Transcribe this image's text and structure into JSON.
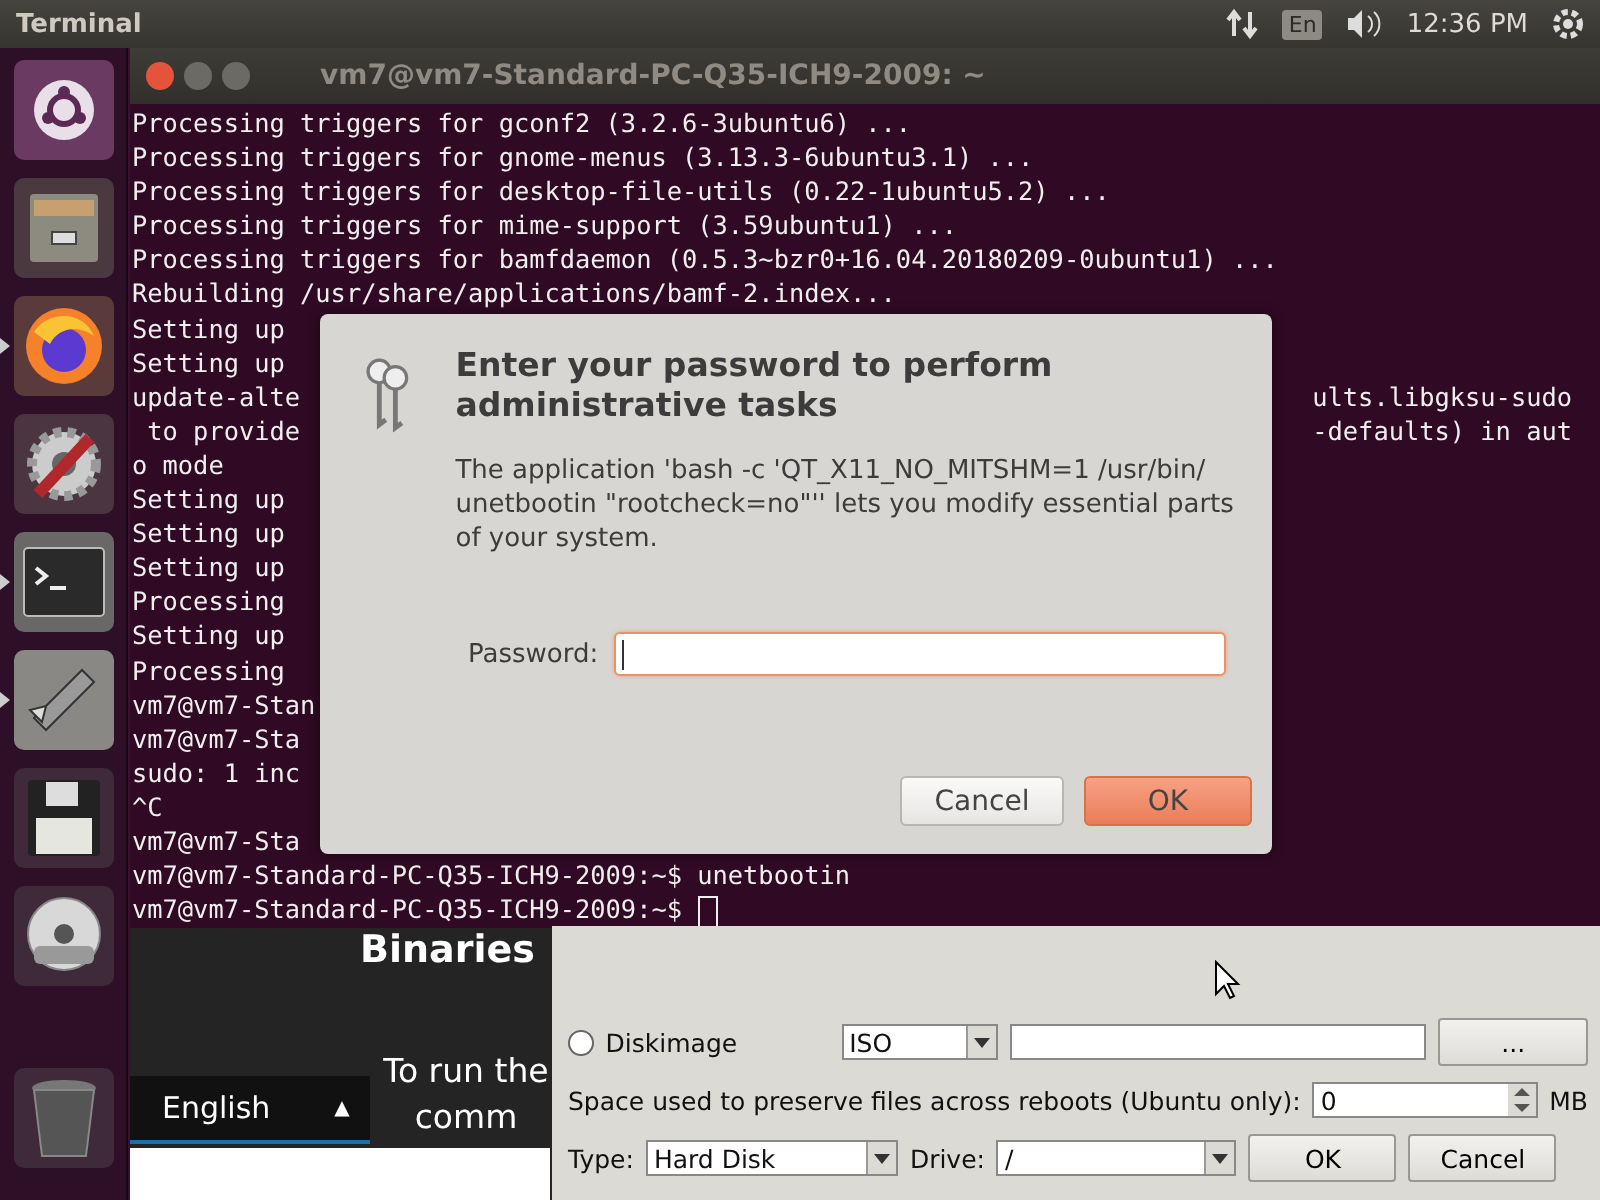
{
  "top_bar": {
    "app_title": "Terminal",
    "keyboard_layout": "En",
    "clock": "12:36 PM"
  },
  "launcher": {
    "items": [
      {
        "kind": "ubuntu",
        "running": false
      },
      {
        "kind": "files",
        "running": false
      },
      {
        "kind": "browser",
        "running": true
      },
      {
        "kind": "settings",
        "running": false
      },
      {
        "kind": "terminal",
        "running": true
      },
      {
        "kind": "usb",
        "running": true
      },
      {
        "kind": "floppy",
        "running": false
      },
      {
        "kind": "dvd",
        "running": false
      },
      {
        "kind": "trash",
        "running": false
      }
    ]
  },
  "terminal": {
    "title": "vm7@vm7-Standard-PC-Q35-ICH9-2009: ~",
    "lines": [
      {
        "left": "Processing triggers for gconf2 (3.2.6-3ubuntu6) ..."
      },
      {
        "left": "Processing triggers for gnome-menus (3.13.3-6ubuntu3.1) ..."
      },
      {
        "left": "Processing triggers for desktop-file-utils (0.22-1ubuntu5.2) ..."
      },
      {
        "left": "Processing triggers for mime-support (3.59ubuntu1) ..."
      },
      {
        "left": "Processing triggers for bamfdaemon (0.5.3~bzr0+16.04.20180209-0ubuntu1) ..."
      },
      {
        "left": "Rebuilding /usr/share/applications/bamf-2.index..."
      },
      {
        "left": "Setting up"
      },
      {
        "left": "Setting up"
      },
      {
        "left": "update-alte",
        "right": "ults.libgksu-sudo"
      },
      {
        "left": " to provide",
        "right": "-defaults) in aut"
      },
      {
        "left": "o mode"
      },
      {
        "left": "Setting up"
      },
      {
        "left": "Setting up"
      },
      {
        "left": "Setting up"
      },
      {
        "left": "Processing"
      },
      {
        "left": "Setting up"
      },
      {
        "left": "Processing"
      },
      {
        "left": "vm7@vm7-Stan"
      },
      {
        "left": "vm7@vm7-Sta"
      },
      {
        "left": "sudo: 1 inc"
      },
      {
        "left": "^C"
      },
      {
        "left": "vm7@vm7-Sta"
      },
      {
        "left": "vm7@vm7-Standard-PC-Q35-ICH9-2009:~$ unetbootin"
      },
      {
        "left": "vm7@vm7-Standard-PC-Q35-ICH9-2009:~$ ",
        "cursor": true
      }
    ]
  },
  "auth_dialog": {
    "heading": "Enter your password to perform administrative tasks",
    "message": "The application 'bash -c 'QT_X11_NO_MITSHM=1 /usr/bin/ unetbootin \"rootcheck=no\"'' lets you modify essential parts of your system.",
    "password_label": "Password:",
    "buttons": [
      {
        "label": "Cancel",
        "kind": "normal"
      },
      {
        "label": "OK",
        "kind": "default"
      }
    ]
  },
  "web_page": {
    "heading": "Binaries",
    "text_lines": [
      "To run the",
      "comm"
    ],
    "language": "English",
    "language_caret": "▲"
  },
  "unetbootin": {
    "diskimage": {
      "label": "Diskimage",
      "selected": false,
      "format": "ISO",
      "browse": "..."
    },
    "persistence": {
      "label": "Space used to preserve files across reboots (Ubuntu only):",
      "value": "0",
      "unit": "MB"
    },
    "type_label": "Type:",
    "type": "Hard Disk",
    "drive_label": "Drive:",
    "drive": "/",
    "buttons": [
      "OK",
      "Cancel"
    ]
  }
}
